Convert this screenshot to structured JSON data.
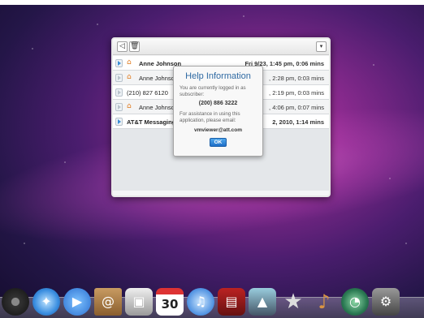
{
  "window": {
    "rows": [
      {
        "name": "Anne Johnson",
        "meta": "Fri 9/23, 1:45 pm, 0:06 mins",
        "bold": true,
        "icon": "house-icon"
      },
      {
        "name": "Anne Johnson",
        "meta": ", 2:28 pm, 0:03 mins",
        "bold": false,
        "icon": "house-icon"
      },
      {
        "name": "(210) 827 6120",
        "meta": ", 2:19 pm, 0:03 mins",
        "bold": false,
        "icon": ""
      },
      {
        "name": "Anne Johnson",
        "meta": ", 4:06 pm, 0:07 mins",
        "bold": false,
        "icon": "house-icon"
      },
      {
        "name": "AT&T Messaging",
        "meta": "2, 2010, 1:14 mins",
        "bold": true,
        "icon": ""
      }
    ]
  },
  "dialog": {
    "title": "Help Information",
    "logged_in_text": "You are currently logged in as subscriber:",
    "phone": "(200) 886 3222",
    "assistance_text": "For assistance in using this application, please email:",
    "email": "vmviewer@att.com",
    "ok_label": "OK"
  },
  "dock": {
    "calendar_day": "30"
  }
}
